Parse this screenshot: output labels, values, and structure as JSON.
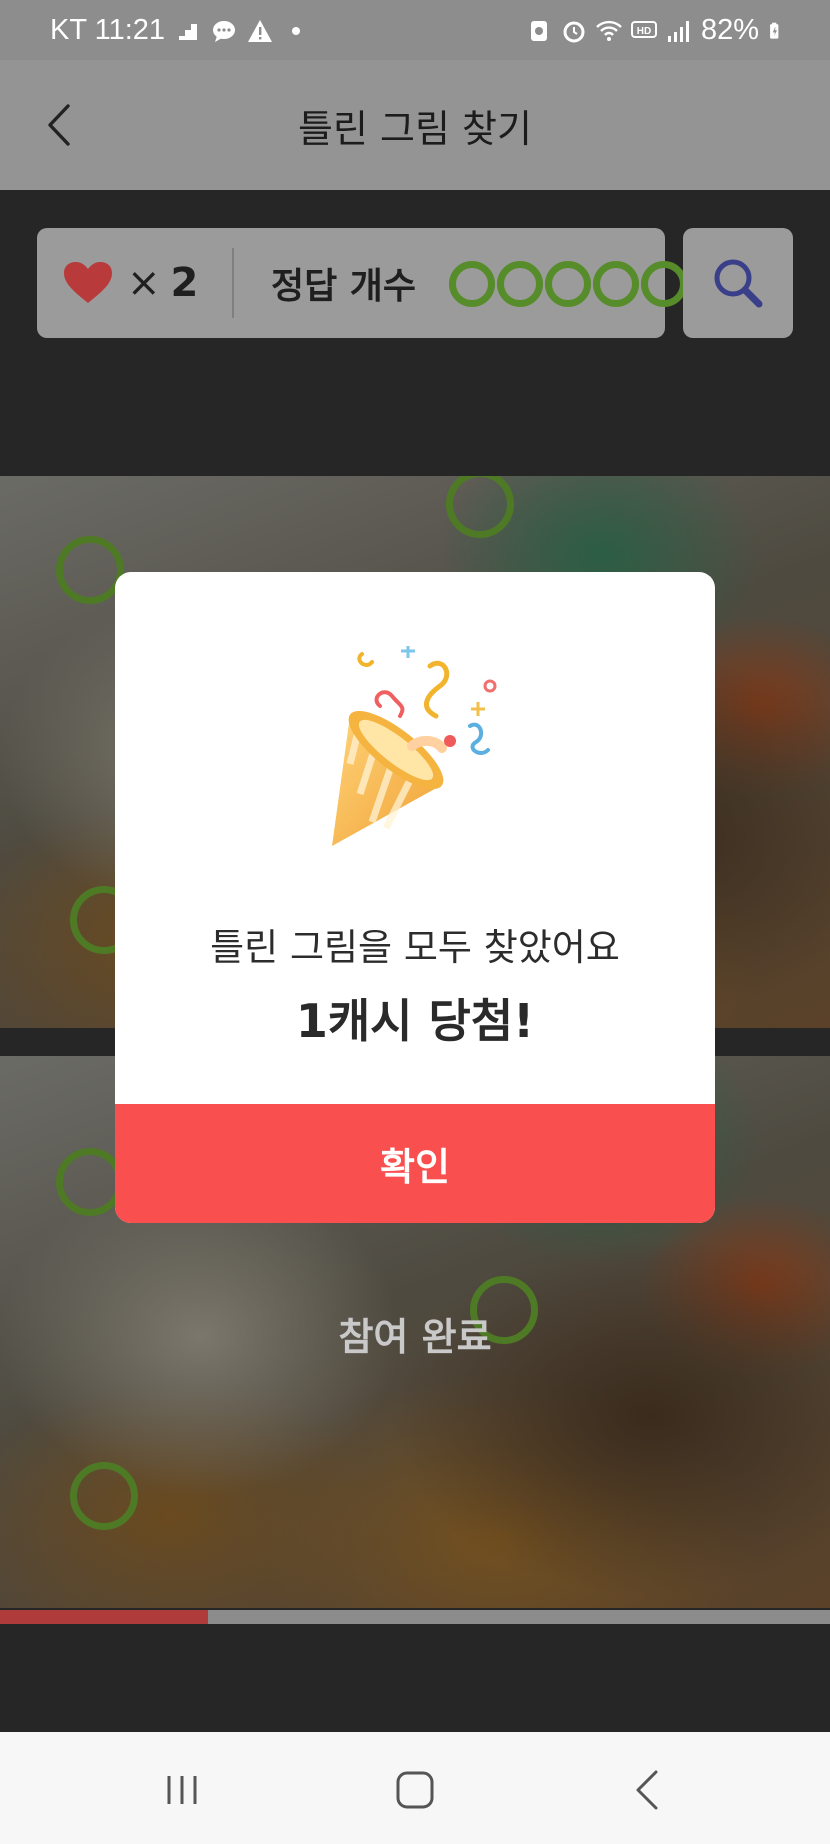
{
  "status_bar": {
    "carrier_time": "KT 11:21",
    "battery": "82%",
    "left_icons": [
      "signal-steps-icon",
      "chat-icon",
      "warning-icon",
      "dot-icon"
    ],
    "right_icons": [
      "sim-icon",
      "alarm-icon",
      "wifi-icon",
      "hd-voice-icon",
      "signal-icon",
      "battery-icon"
    ]
  },
  "header": {
    "title": "틀린 그림 찾기"
  },
  "info_bar": {
    "lives_symbol": "×",
    "lives_count": "2",
    "answer_label": "정답 개수",
    "answers_found": 5,
    "answers_total": 5
  },
  "photo": {
    "done_label": "참여 완료"
  },
  "progress": {
    "fraction": 0.25
  },
  "modal": {
    "message": "틀린 그림을 모두 찾았어요",
    "prize": "1캐시 당첨!",
    "confirm_label": "확인"
  },
  "colors": {
    "accent_red": "#fa4f4f",
    "circle_green": "#578c2a",
    "heart_red": "#b83a3a"
  }
}
